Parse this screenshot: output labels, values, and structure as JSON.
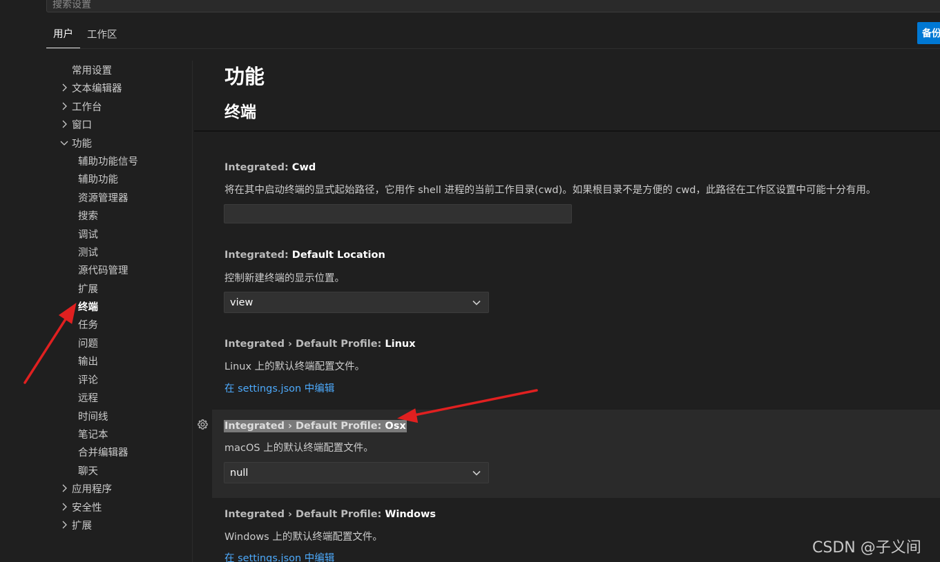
{
  "search": {
    "placeholder": "搜索设置"
  },
  "tabs": [
    {
      "label": "用户"
    },
    {
      "label": "工作区"
    }
  ],
  "backup_button": {
    "label": "备份"
  },
  "tree": [
    {
      "label": "常用设置",
      "chevron": "none",
      "level": 0
    },
    {
      "label": "文本编辑器",
      "chevron": "right",
      "level": 0
    },
    {
      "label": "工作台",
      "chevron": "right",
      "level": 0
    },
    {
      "label": "窗口",
      "chevron": "right",
      "level": 0
    },
    {
      "label": "功能",
      "chevron": "down",
      "level": 0
    },
    {
      "label": "辅助功能信号",
      "chevron": "none",
      "level": 1
    },
    {
      "label": "辅助功能",
      "chevron": "none",
      "level": 1
    },
    {
      "label": "资源管理器",
      "chevron": "none",
      "level": 1
    },
    {
      "label": "搜索",
      "chevron": "none",
      "level": 1
    },
    {
      "label": "调试",
      "chevron": "none",
      "level": 1
    },
    {
      "label": "测试",
      "chevron": "none",
      "level": 1
    },
    {
      "label": "源代码管理",
      "chevron": "none",
      "level": 1
    },
    {
      "label": "扩展",
      "chevron": "none",
      "level": 1
    },
    {
      "label": "终端",
      "chevron": "none",
      "level": 1,
      "selected": true
    },
    {
      "label": "任务",
      "chevron": "none",
      "level": 1
    },
    {
      "label": "问题",
      "chevron": "none",
      "level": 1
    },
    {
      "label": "输出",
      "chevron": "none",
      "level": 1
    },
    {
      "label": "评论",
      "chevron": "none",
      "level": 1
    },
    {
      "label": "远程",
      "chevron": "none",
      "level": 1
    },
    {
      "label": "时间线",
      "chevron": "none",
      "level": 1
    },
    {
      "label": "笔记本",
      "chevron": "none",
      "level": 1
    },
    {
      "label": "合并编辑器",
      "chevron": "none",
      "level": 1
    },
    {
      "label": "聊天",
      "chevron": "none",
      "level": 1
    },
    {
      "label": "应用程序",
      "chevron": "right",
      "level": 0
    },
    {
      "label": "安全性",
      "chevron": "right",
      "level": 0
    },
    {
      "label": "扩展",
      "chevron": "right",
      "level": 0
    }
  ],
  "content": {
    "heading": "功能",
    "subheading": "终端",
    "settings": [
      {
        "prefix": "Integrated: ",
        "key": "Cwd",
        "description": "将在其中启动终端的显式起始路径，它用作 shell 进程的当前工作目录(cwd)。如果根目录不是方便的 cwd，此路径在工作区设置中可能十分有用。",
        "value": ""
      },
      {
        "prefix": "Integrated: ",
        "key": "Default Location",
        "description": "控制新建终端的显示位置。",
        "value": "view"
      },
      {
        "prefix": "Integrated › Default Profile: ",
        "key": "Linux",
        "description": "Linux 上的默认终端配置文件。",
        "link": "在 settings.json 中编辑"
      },
      {
        "prefix": "Integrated › Default Profile: ",
        "key": "Osx",
        "description": "macOS 上的默认终端配置文件。",
        "value": "null"
      },
      {
        "prefix": "Integrated › Default Profile: ",
        "key": "Windows",
        "description": "Windows 上的默认终端配置文件。",
        "link": "在 settings.json 中编辑"
      }
    ]
  },
  "watermark": "CSDN @子义间",
  "colors": {
    "background": "#1f1f1f",
    "accent": "#0078d4",
    "link": "#4daafc",
    "annotation_arrow": "#e02020"
  },
  "icons": [
    "chevron-right-icon",
    "chevron-down-icon",
    "gear-icon"
  ]
}
